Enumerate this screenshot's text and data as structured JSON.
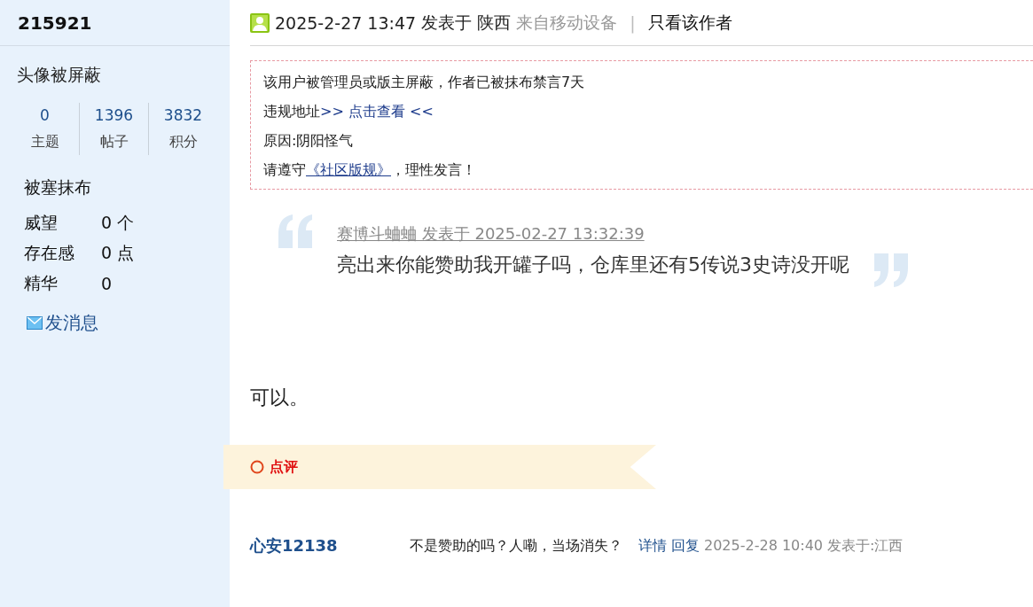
{
  "sidebar": {
    "user_id": "215921",
    "avatar_note": "头像被屏蔽",
    "stats": [
      {
        "value": "0",
        "label": "主题"
      },
      {
        "value": "1396",
        "label": "帖子"
      },
      {
        "value": "3832",
        "label": "积分"
      }
    ],
    "group": "被塞抹布",
    "details": [
      {
        "label": "威望",
        "value": "0 个"
      },
      {
        "label": "存在感",
        "value": "0 点"
      },
      {
        "label": "精华",
        "value": "0"
      }
    ],
    "message_link": "发消息"
  },
  "post": {
    "meta": {
      "date": "2025-2-27 13:47",
      "posted_in": "发表于 陕西",
      "source": "来自移动设备",
      "separator": "|",
      "author_only": "只看该作者"
    },
    "notice": [
      [
        {
          "text": "该用户被管理员或版主屏蔽，作者已被抹布禁言7天",
          "kind": "plain"
        }
      ],
      [
        {
          "text": "违规地址",
          "kind": "plain"
        },
        {
          "text": ">> 点击查看 <<",
          "kind": "link"
        }
      ],
      [
        {
          "text": "原因:阴阳怪气",
          "kind": "plain"
        }
      ],
      [
        {
          "text": "请遵守",
          "kind": "plain"
        },
        {
          "text": "《社区版规》",
          "kind": "underlined_link"
        },
        {
          "text": "，理性发言！",
          "kind": "plain"
        }
      ]
    ],
    "quote": {
      "author_line": "赛博斗蛐蛐 发表于 2025-02-27 13:32:39",
      "text": "亮出来你能赞助我开罐子吗，仓库里还有5传说3史诗没开呢"
    },
    "body": "可以。",
    "comments": {
      "title": "点评",
      "items": [
        {
          "user": "心安12138",
          "text": "不是赞助的吗？人嘞，当场消失？",
          "actions": [
            "详情",
            "回复"
          ],
          "time": "2025-2-28 10:40 发表于:江西"
        }
      ]
    }
  }
}
